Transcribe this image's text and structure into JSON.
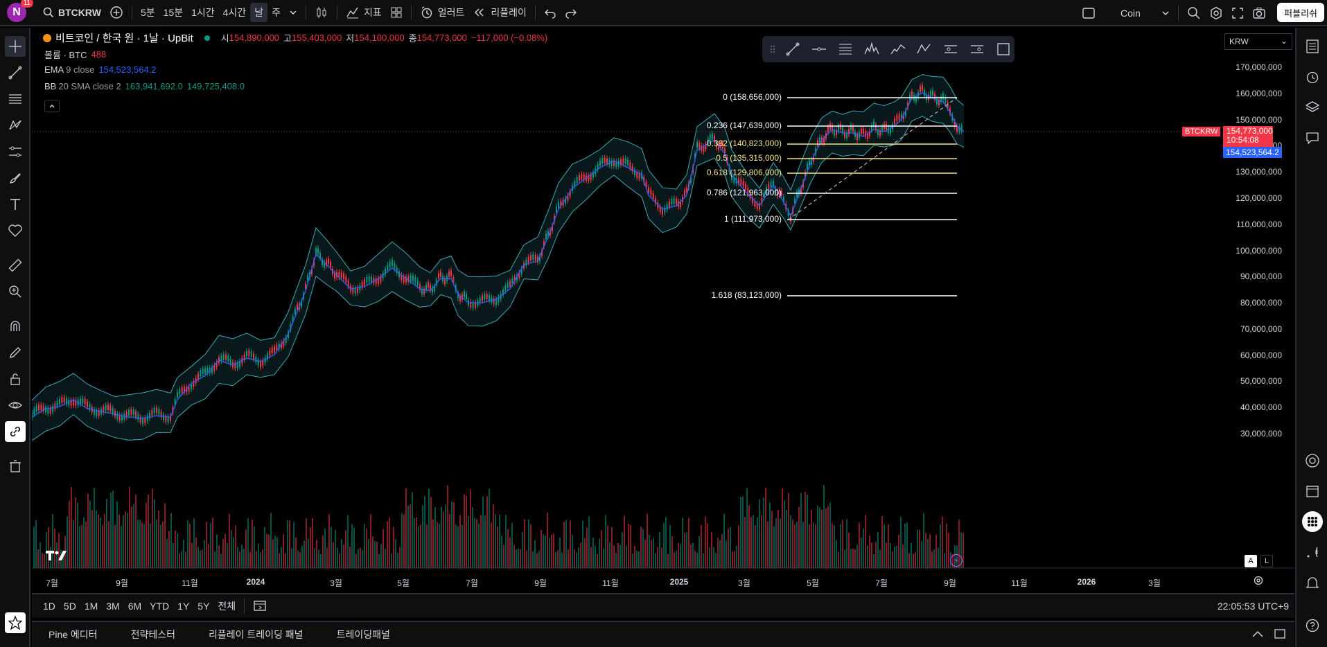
{
  "topbar": {
    "avatar_letter": "N",
    "notifications": "11",
    "symbol": "BTCKRW",
    "intervals": [
      "5분",
      "15분",
      "1시간",
      "4시간",
      "날",
      "주"
    ],
    "active_interval": "날",
    "indicators_label": "지표",
    "alert_label": "얼러트",
    "replay_label": "리플레이",
    "layout_name": "Coin",
    "publish_label": "퍼블리쉬"
  },
  "legend": {
    "title": "비트코인 / 한국 원 · 1날 · UpBit",
    "o_label": "시",
    "o_value": "154,890,000",
    "h_label": "고",
    "h_value": "155,403,000",
    "l_label": "저",
    "l_value": "154,100,000",
    "c_label": "종",
    "c_value": "154,773,000",
    "change": "−117,000 (−0.08%)",
    "volume_label": "볼륨 · BTC",
    "volume_value": "488",
    "ema_label": "EMA",
    "ema_params": "9 close",
    "ema_value": "154,523,564.2",
    "bb_label": "BB",
    "bb_params": "20 SMA close 2",
    "bb_upper": "163,941,692.0",
    "bb_lower": "149,725,408.0"
  },
  "currency": "KRW",
  "price_axis": [
    "170,000,000",
    "160,000,000",
    "150,000,000",
    "140,000,000",
    "130,000,000",
    "120,000,000",
    "110,000,000",
    "100,000,000",
    "90,000,000",
    "80,000,000",
    "70,000,000",
    "60,000,000",
    "50,000,000",
    "40,000,000",
    "30,000,000"
  ],
  "time_axis": [
    "7월",
    "9월",
    "11월",
    "2024",
    "3월",
    "5월",
    "7월",
    "9월",
    "11월",
    "2025",
    "3월",
    "5월",
    "7월",
    "9월",
    "11월",
    "2026",
    "3월"
  ],
  "fib_levels": [
    {
      "label": "0 (158,656,000)",
      "color": "#ffffff"
    },
    {
      "label": "0.236 (147,639,000)",
      "color": "#ffffff"
    },
    {
      "label": "0.382 (140,823,000)",
      "color": "#f7e58d"
    },
    {
      "label": "0.5 (135,315,000)",
      "color": "#f7e58d"
    },
    {
      "label": "0.618 (129,806,000)",
      "color": "#f7e58d"
    },
    {
      "label": "0.786 (121,963,000)",
      "color": "#ffffff"
    },
    {
      "label": "1 (111,973,000)",
      "color": "#ffffff"
    },
    {
      "label": "1.618 (83,123,000)",
      "color": "#ffffff"
    }
  ],
  "price_tags": {
    "symbol": "BTCKRW",
    "last_price": "154,773,000",
    "countdown": "10:54:08",
    "ema_price": "154,523,564.2"
  },
  "axis_modes": [
    "A",
    "L"
  ],
  "ranges": [
    "1D",
    "5D",
    "1M",
    "3M",
    "6M",
    "YTD",
    "1Y",
    "5Y",
    "전체"
  ],
  "clock": "22:05:53 UTC+9",
  "panels": [
    "Pine 에디터",
    "전략테스터",
    "리플레이 트레이딩 패널",
    "트레이딩패널"
  ],
  "colors": {
    "up": "#089981",
    "down": "#f23645",
    "ema": "#2962ff",
    "bb_band": "#4dd0e1",
    "accent": "#2962ff"
  }
}
